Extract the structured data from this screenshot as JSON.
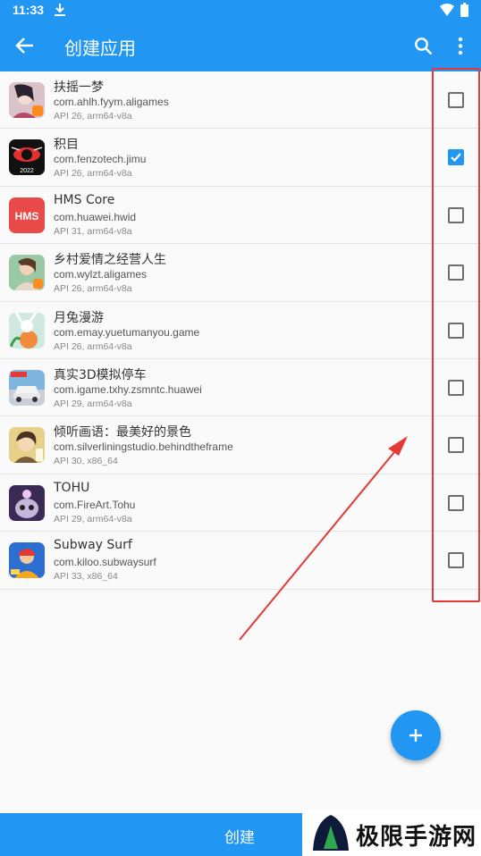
{
  "status_bar": {
    "time": "11:33"
  },
  "app_bar": {
    "title": "创建应用"
  },
  "apps": [
    {
      "name": "扶摇一梦",
      "package": "com.ahlh.fyym.aligames",
      "api": "API 26, arm64-v8a",
      "checked": false,
      "icon": "fuyao-icon"
    },
    {
      "name": "积目",
      "package": "com.fenzotech.jimu",
      "api": "API 26, arm64-v8a",
      "checked": true,
      "icon": "jimu-icon",
      "icon_text": "2022"
    },
    {
      "name": "HMS Core",
      "package": "com.huawei.hwid",
      "api": "API 31, arm64-v8a",
      "checked": false,
      "icon": "hms-icon",
      "icon_text": "HMS"
    },
    {
      "name": "乡村爱情之经营人生",
      "package": "com.wylzt.aligames",
      "api": "API 26, arm64-v8a",
      "checked": false,
      "icon": "xiangcun-icon"
    },
    {
      "name": "月兔漫游",
      "package": "com.emay.yuetumanyou.game",
      "api": "API 26, arm64-v8a",
      "checked": false,
      "icon": "yuetu-icon"
    },
    {
      "name": "真实3D模拟停车",
      "package": "com.igame.txhy.zsmntc.huawei",
      "api": "API 29, arm64-v8a",
      "checked": false,
      "icon": "parking-icon"
    },
    {
      "name": "倾听画语：最美好的景色",
      "package": "com.silverliningstudio.behindtheframe",
      "api": "API 30, x86_64",
      "checked": false,
      "icon": "behindframe-icon"
    },
    {
      "name": "TOHU",
      "package": "com.FireArt.Tohu",
      "api": "API 29, arm64-v8a",
      "checked": false,
      "icon": "tohu-icon"
    },
    {
      "name": "Subway Surf",
      "package": "com.kiloo.subwaysurf",
      "api": "API 33, x86_64",
      "checked": false,
      "icon": "subway-icon"
    }
  ],
  "bottom_bar": {
    "create_label": "创建"
  },
  "watermark": {
    "text": "极限手游网"
  },
  "colors": {
    "primary": "#2196f3",
    "annotation": "#e53935"
  }
}
